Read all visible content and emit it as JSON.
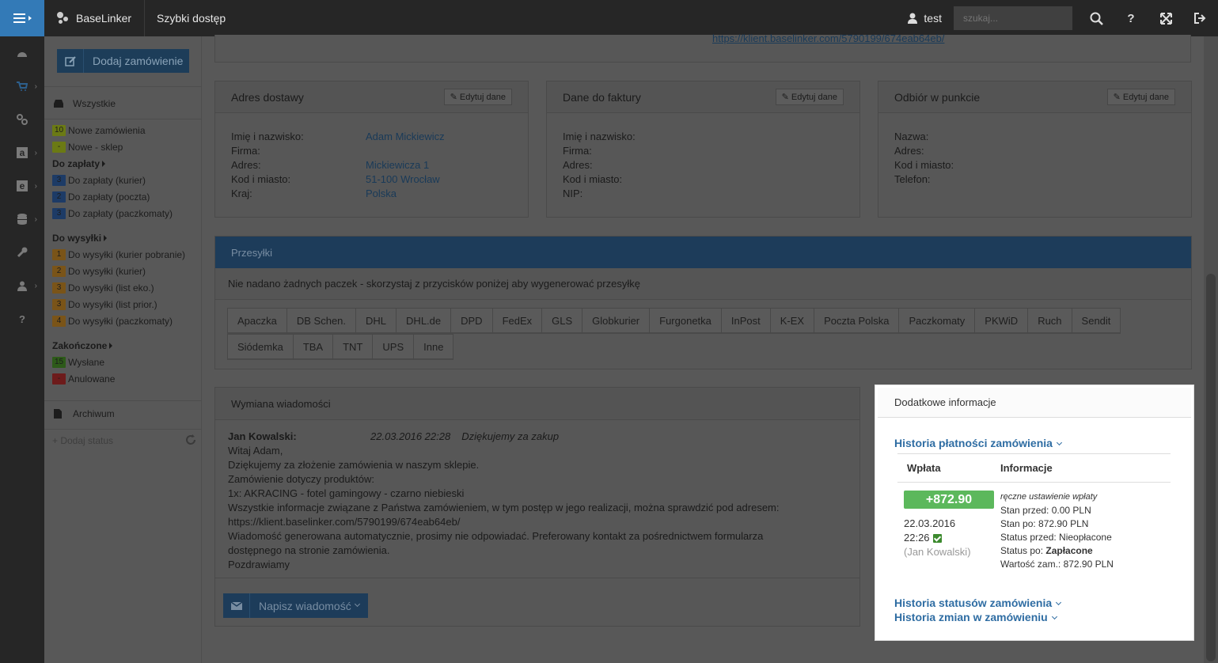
{
  "topbar": {
    "brand": "BaseLinker",
    "quick_access": "Szybki dostęp",
    "user": "test",
    "search_placeholder": "szukaj..."
  },
  "sidebar": {
    "add_order": "Dodaj zamówienie",
    "all": "Wszystkie",
    "new_orders": {
      "count": "10",
      "label": "Nowe zamówienia"
    },
    "new_shop": {
      "count": "-",
      "label": "Nowe - sklep"
    },
    "to_pay": "Do zapłaty",
    "to_pay_items": [
      {
        "count": "3",
        "label": "Do zapłaty (kurier)"
      },
      {
        "count": "2",
        "label": "Do zapłaty (poczta)"
      },
      {
        "count": "3",
        "label": "Do zapłaty (paczkomaty)"
      }
    ],
    "to_ship": "Do wysyłki",
    "to_ship_items": [
      {
        "count": "1",
        "label": "Do wysyłki (kurier pobranie)"
      },
      {
        "count": "2",
        "label": "Do wysyłki (kurier)"
      },
      {
        "count": "3",
        "label": "Do wysyłki (list eko.)"
      },
      {
        "count": "3",
        "label": "Do wysyłki (list prior.)"
      },
      {
        "count": "4",
        "label": "Do wysyłki (paczkomaty)"
      }
    ],
    "finished": "Zakończone",
    "finished_items": [
      {
        "count": "15",
        "label": "Wysłane"
      },
      {
        "count": "-",
        "label": "Anulowane"
      }
    ],
    "archive": "Archiwum",
    "add_status": "+ Dodaj status"
  },
  "top_link": "https://klient.baselinker.com/5790199/674eab64eb/",
  "delivery": {
    "title": "Adres dostawy",
    "edit": "Edytuj dane",
    "fields": [
      {
        "k": "Imię i nazwisko:",
        "v": "Adam Mickiewicz"
      },
      {
        "k": "Firma:",
        "v": ""
      },
      {
        "k": "Adres:",
        "v": "Mickiewicza 1"
      },
      {
        "k": "Kod i miasto:",
        "v": "51-100 Wrocław"
      },
      {
        "k": "Kraj:",
        "v": "Polska"
      }
    ]
  },
  "invoice": {
    "title": "Dane do faktury",
    "edit": "Edytuj dane",
    "fields": [
      {
        "k": "Imię i nazwisko:",
        "v": ""
      },
      {
        "k": "Firma:",
        "v": ""
      },
      {
        "k": "Adres:",
        "v": ""
      },
      {
        "k": "Kod i miasto:",
        "v": ""
      },
      {
        "k": "NIP:",
        "v": ""
      }
    ]
  },
  "pickup": {
    "title": "Odbiór w punkcie",
    "edit": "Edytuj dane",
    "fields": [
      {
        "k": "Nazwa:",
        "v": ""
      },
      {
        "k": "Adres:",
        "v": ""
      },
      {
        "k": "Kod i miasto:",
        "v": ""
      },
      {
        "k": "Telefon:",
        "v": ""
      }
    ]
  },
  "shipments": {
    "title": "Przesyłki",
    "info": "Nie nadano żadnych paczek - skorzystaj z przycisków poniżej aby wygenerować przesyłkę",
    "carriers_row1": [
      "Apaczka",
      "DB Schen.",
      "DHL",
      "DHL.de",
      "DPD",
      "FedEx",
      "GLS",
      "Globkurier",
      "Furgonetka",
      "InPost",
      "K-EX",
      "Poczta Polska",
      "Paczkomaty",
      "PKWiD",
      "Ruch",
      "Sendit"
    ],
    "carriers_row2": [
      "Siódemka",
      "TBA",
      "TNT",
      "UPS",
      "Inne"
    ]
  },
  "messages": {
    "title": "Wymiana wiadomości",
    "author": "Jan Kowalski:",
    "date": "22.03.2016 22:28",
    "subject": "Dziękujemy za zakup",
    "lines": [
      "Witaj Adam,",
      "Dziękujemy za złożenie zamówienia w naszym sklepie.",
      "Zamówienie dotyczy produktów:",
      "1x: AKRACING - fotel gamingowy - czarno niebieski",
      "Wszystkie informacje związane z Państwa zamówieniem, w tym postęp w jego realizacji, można sprawdzić pod adresem:",
      "https://klient.baselinker.com/5790199/674eab64eb/",
      "Wiadomość generowana automatycznie, prosimy nie odpowiadać. Preferowany kontakt za pośrednictwem formularza",
      "dostępnego na stronie zamówienia.",
      "Pozdrawiamy"
    ],
    "write_button": "Napisz wiadomość"
  },
  "extra": {
    "title": "Dodatkowe informacje",
    "payment_history": "Historia płatności zamówienia",
    "col_payment": "Wpłata",
    "col_info": "Informacje",
    "amount": "+872.90",
    "date": "22.03.2016",
    "time": "22:26",
    "user": "(Jan Kowalski)",
    "info_note": "ręczne ustawienie wpłaty",
    "info_before": "Stan przed: 0.00 PLN",
    "info_after": "Stan po: 872.90 PLN",
    "status_before": "Status przed: Nieopłacone",
    "status_after_label": "Status po: ",
    "status_after_value": "Zapłacone",
    "order_value": "Wartość zam.: 872.90 PLN",
    "status_history": "Historia statusów zamówienia",
    "changes_history": "Historia zmian w zamówieniu"
  }
}
